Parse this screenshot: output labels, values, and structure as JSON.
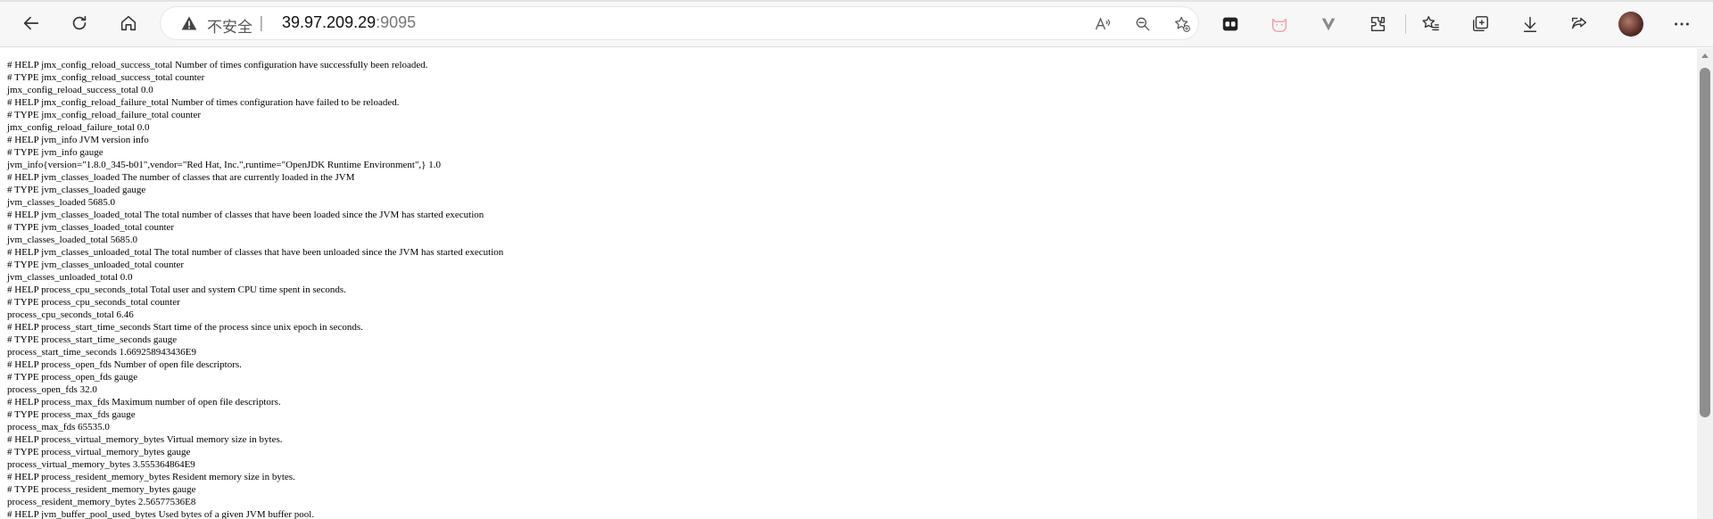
{
  "browser": {
    "security_label": "不安全",
    "separator": "|",
    "url_host": "39.97.209.29",
    "url_port": ":9095",
    "icons": {
      "back": "back-arrow-icon",
      "refresh": "refresh-icon",
      "home": "home-icon",
      "warning": "warning-triangle-icon",
      "read_aloud": "read-aloud-icon",
      "zoom_out": "zoom-out-icon",
      "favorite_add": "star-add-icon",
      "extension_1": "extension-icon",
      "extension_2": "cat-extension-icon",
      "extension_3": "v-extension-icon",
      "extensions": "puzzle-icon",
      "favorites": "favorites-icon",
      "collections": "collections-icon",
      "downloads": "download-icon",
      "share": "share-icon",
      "profile": "avatar",
      "more": "more-icon"
    }
  },
  "metrics_lines": [
    "# HELP jmx_config_reload_success_total Number of times configuration have successfully been reloaded.",
    "# TYPE jmx_config_reload_success_total counter",
    "jmx_config_reload_success_total 0.0",
    "# HELP jmx_config_reload_failure_total Number of times configuration have failed to be reloaded.",
    "# TYPE jmx_config_reload_failure_total counter",
    "jmx_config_reload_failure_total 0.0",
    "# HELP jvm_info JVM version info",
    "# TYPE jvm_info gauge",
    "jvm_info{version=\"1.8.0_345-b01\",vendor=\"Red Hat, Inc.\",runtime=\"OpenJDK Runtime Environment\",} 1.0",
    "# HELP jvm_classes_loaded The number of classes that are currently loaded in the JVM",
    "# TYPE jvm_classes_loaded gauge",
    "jvm_classes_loaded 5685.0",
    "# HELP jvm_classes_loaded_total The total number of classes that have been loaded since the JVM has started execution",
    "# TYPE jvm_classes_loaded_total counter",
    "jvm_classes_loaded_total 5685.0",
    "# HELP jvm_classes_unloaded_total The total number of classes that have been unloaded since the JVM has started execution",
    "# TYPE jvm_classes_unloaded_total counter",
    "jvm_classes_unloaded_total 0.0",
    "# HELP process_cpu_seconds_total Total user and system CPU time spent in seconds.",
    "# TYPE process_cpu_seconds_total counter",
    "process_cpu_seconds_total 6.46",
    "# HELP process_start_time_seconds Start time of the process since unix epoch in seconds.",
    "# TYPE process_start_time_seconds gauge",
    "process_start_time_seconds 1.669258943436E9",
    "# HELP process_open_fds Number of open file descriptors.",
    "# TYPE process_open_fds gauge",
    "process_open_fds 32.0",
    "# HELP process_max_fds Maximum number of open file descriptors.",
    "# TYPE process_max_fds gauge",
    "process_max_fds 65535.0",
    "# HELP process_virtual_memory_bytes Virtual memory size in bytes.",
    "# TYPE process_virtual_memory_bytes gauge",
    "process_virtual_memory_bytes 3.555364864E9",
    "# HELP process_resident_memory_bytes Resident memory size in bytes.",
    "# TYPE process_resident_memory_bytes gauge",
    "process_resident_memory_bytes 2.56577536E8",
    "# HELP jvm_buffer_pool_used_bytes Used bytes of a given JVM buffer pool."
  ]
}
